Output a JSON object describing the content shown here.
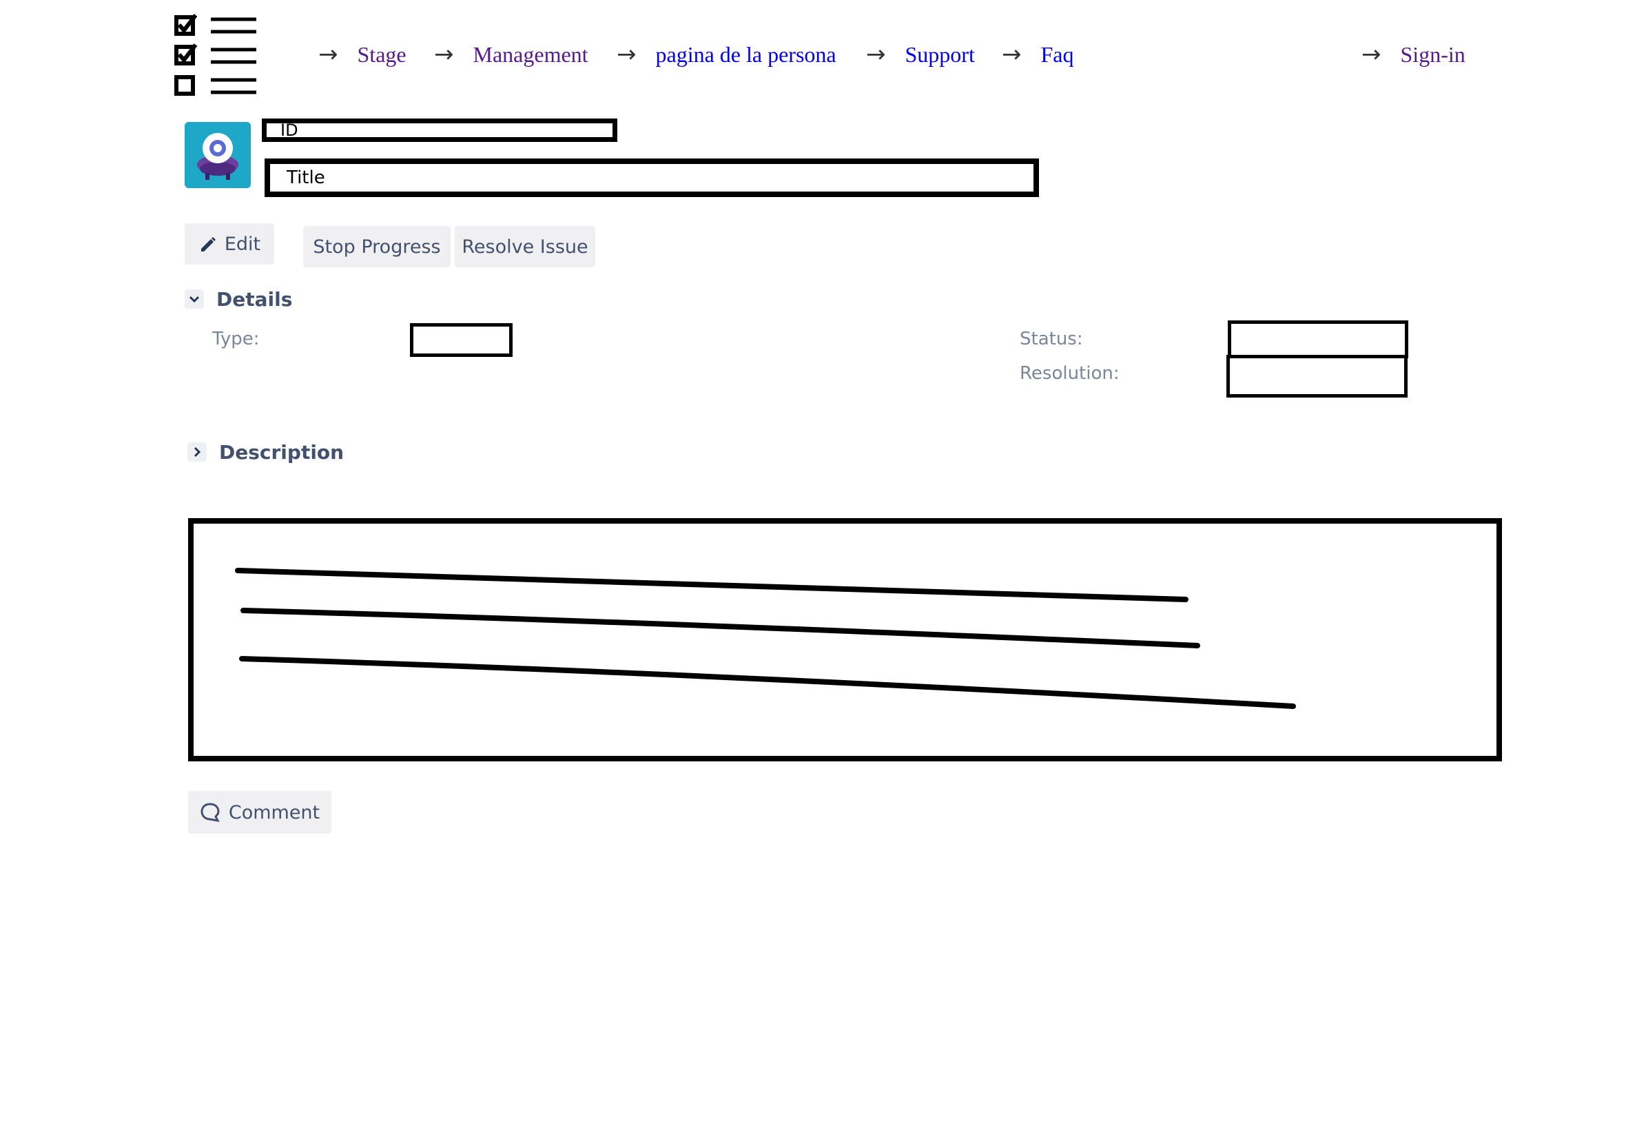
{
  "nav": {
    "links": [
      {
        "label": "Stage"
      },
      {
        "label": "Management"
      },
      {
        "label": "pagina de la persona"
      },
      {
        "label": "Support"
      },
      {
        "label": "Faq"
      },
      {
        "label": "Sign-in"
      }
    ],
    "arrow": "→"
  },
  "issue": {
    "id_label": "ID",
    "title_label": "Title"
  },
  "toolbar": {
    "edit_label": "Edit",
    "stop_progress_label": "Stop Progress",
    "resolve_issue_label": "Resolve Issue"
  },
  "details": {
    "heading": "Details",
    "type_label": "Type:",
    "status_label": "Status:",
    "resolution_label": "Resolution:"
  },
  "description": {
    "heading": "Description"
  },
  "comment": {
    "label": "Comment"
  },
  "colors": {
    "visited_link": "#551a8b",
    "unvisited_link": "#0000ee",
    "avatar_bg": "#1fa7c7",
    "button_bg": "#f0f0f2",
    "label_grey": "#7a869a"
  }
}
